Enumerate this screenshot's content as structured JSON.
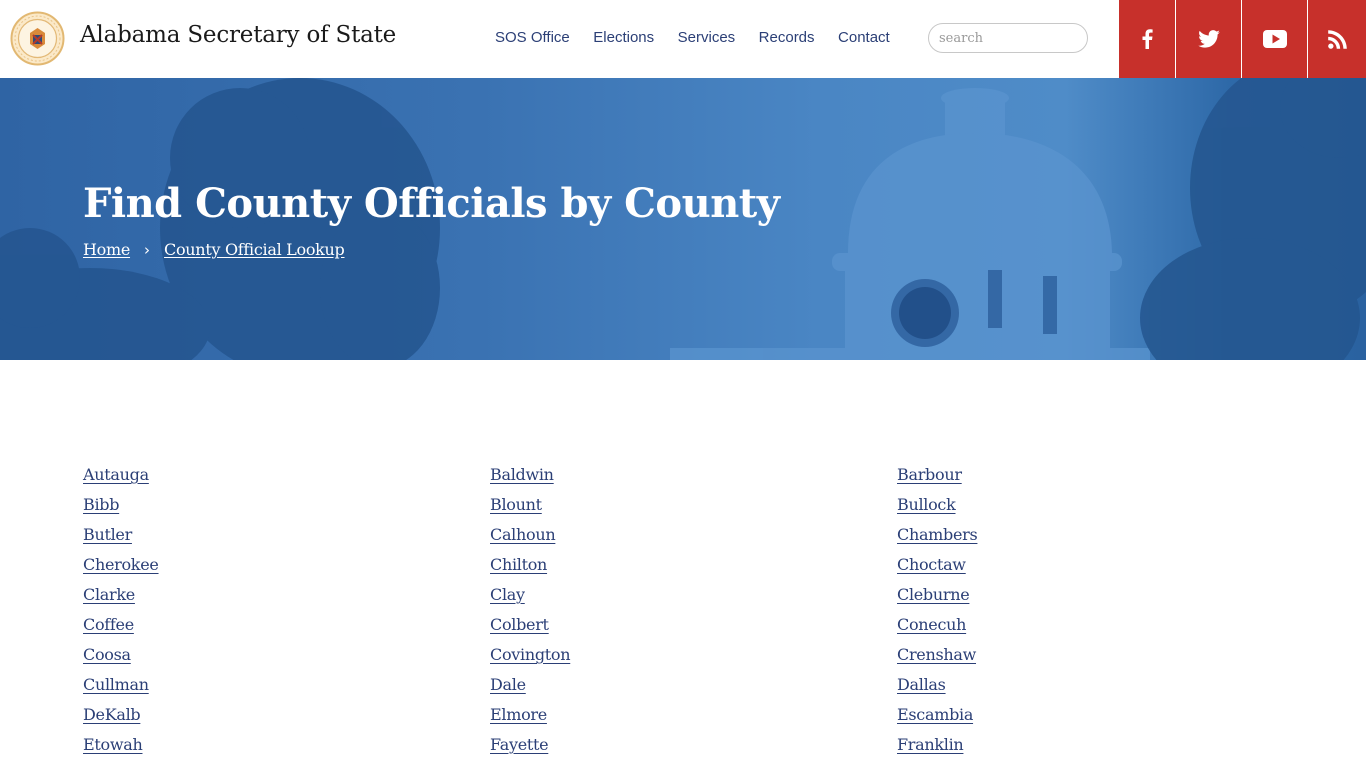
{
  "header": {
    "site_title": "Alabama Secretary of State",
    "logo_alt": "Alabama Secretary of State seal",
    "nav": [
      {
        "label": "SOS Office"
      },
      {
        "label": "Elections"
      },
      {
        "label": "Services"
      },
      {
        "label": "Records"
      },
      {
        "label": "Contact"
      }
    ],
    "search": {
      "placeholder": "search",
      "value": ""
    },
    "social": [
      {
        "name": "facebook",
        "icon": "facebook-icon"
      },
      {
        "name": "twitter",
        "icon": "twitter-icon"
      },
      {
        "name": "youtube",
        "icon": "youtube-icon"
      },
      {
        "name": "rss",
        "icon": "rss-icon"
      }
    ]
  },
  "hero": {
    "title": "Find County Officials by County",
    "breadcrumb": [
      {
        "label": "Home"
      },
      {
        "label": "County Official Lookup"
      }
    ],
    "separator_icon": "chevron-right-icon"
  },
  "counties": [
    "Autauga",
    "Baldwin",
    "Barbour",
    "Bibb",
    "Blount",
    "Bullock",
    "Butler",
    "Calhoun",
    "Chambers",
    "Cherokee",
    "Chilton",
    "Choctaw",
    "Clarke",
    "Clay",
    "Cleburne",
    "Coffee",
    "Colbert",
    "Conecuh",
    "Coosa",
    "Covington",
    "Crenshaw",
    "Cullman",
    "Dale",
    "Dallas",
    "DeKalb",
    "Elmore",
    "Escambia",
    "Etowah",
    "Fayette",
    "Franklin"
  ],
  "colors": {
    "brand_red": "#c7302b",
    "nav_text": "#2b3f76",
    "hero_blue": "#3a72b2",
    "link": "#2b3f76"
  }
}
